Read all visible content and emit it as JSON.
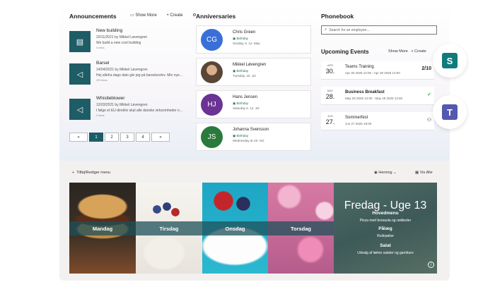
{
  "announcements": {
    "title": "Announcements",
    "show_more": "Show More",
    "create": "Create",
    "items": [
      {
        "title": "New building",
        "date": "23/11/2021 by Mikkel Løvengren",
        "desc": "We build a new cool building",
        "meta": "0 views"
      },
      {
        "title": "Barsel",
        "date": "14/04/2021 by Mikkel Løvengren",
        "desc": "Hej allefra dags dato går jeg på barselsorlov. Min nyeste barselsorlov Line-Marie...",
        "meta": "209 views"
      },
      {
        "title": "Whistleblower",
        "date": "12/03/2021 by Mikkel Løvengren",
        "desc": "I følge et EU-direktiv skal alle danske virksomheder og organisationer med mere...",
        "meta": "0 views"
      }
    ],
    "pager": [
      "«",
      "1",
      "2",
      "3",
      "4",
      "»"
    ]
  },
  "anniversaries": {
    "title": "Anniversaries",
    "items": [
      {
        "initials": "CG",
        "name": "Chris Green",
        "label": "Birthday",
        "date": "Sunday, 6. 12. May",
        "color": "#3a6fd8"
      },
      {
        "initials": "",
        "name": "Mikkel Løvengren",
        "label": "Birthday",
        "date": "Tuesday, 10. Jul",
        "color": "#5a4636"
      },
      {
        "initials": "HJ",
        "name": "Hans Jensen",
        "label": "Birthday",
        "date": "Saturday 6. 12. Jul",
        "color": "#6a3394"
      },
      {
        "initials": "JS",
        "name": "Johanna Svensson",
        "label": "Birthday",
        "date": "Wednesday at 19. Oct",
        "color": "#2a7a3b"
      }
    ]
  },
  "phonebook": {
    "title": "Phonebook",
    "search_placeholder": "Search for an employee..."
  },
  "events": {
    "title": "Upcoming Events",
    "show_more": "Show More",
    "create": "Create",
    "items": [
      {
        "month": "APR",
        "day": "30.",
        "name": "Teams Training",
        "time": "Apr 30 2025 12:00 - Apr 30 2025 13:00",
        "right": "2/10"
      },
      {
        "month": "MAY",
        "day": "28.",
        "name": "Business Breakfast",
        "time": "May 28 2025 12:00 - May 28 2025 13:00",
        "right": "✓"
      },
      {
        "month": "JUN",
        "day": "27.",
        "name": "Sommerfest",
        "time": "Jun 27 2025 18:00",
        "right": "⚇"
      }
    ]
  },
  "menu_bar": {
    "add_label": "Tilføj/Rediger menu",
    "location": "Herning",
    "view_all": "Vis Alle"
  },
  "days": [
    "Mandag",
    "Tirsdag",
    "Onsdag",
    "Torsdag"
  ],
  "friday": {
    "head": "Fredag - Uge 13",
    "main_title": "Hovedmenu",
    "main_desc": "Pizza med bresaola og rødbeder",
    "dessert_title": "Pålæg",
    "dessert_desc": "Rullepølse",
    "salad_title": "Salat",
    "salad_desc": "Udvalg af lækre salater og garniture"
  },
  "apps": {
    "sharepoint": "S",
    "teams": "T"
  },
  "colors": {
    "accent": "#1e5c66",
    "sharepoint": "#0f7b7d",
    "teams": "#5558af"
  }
}
